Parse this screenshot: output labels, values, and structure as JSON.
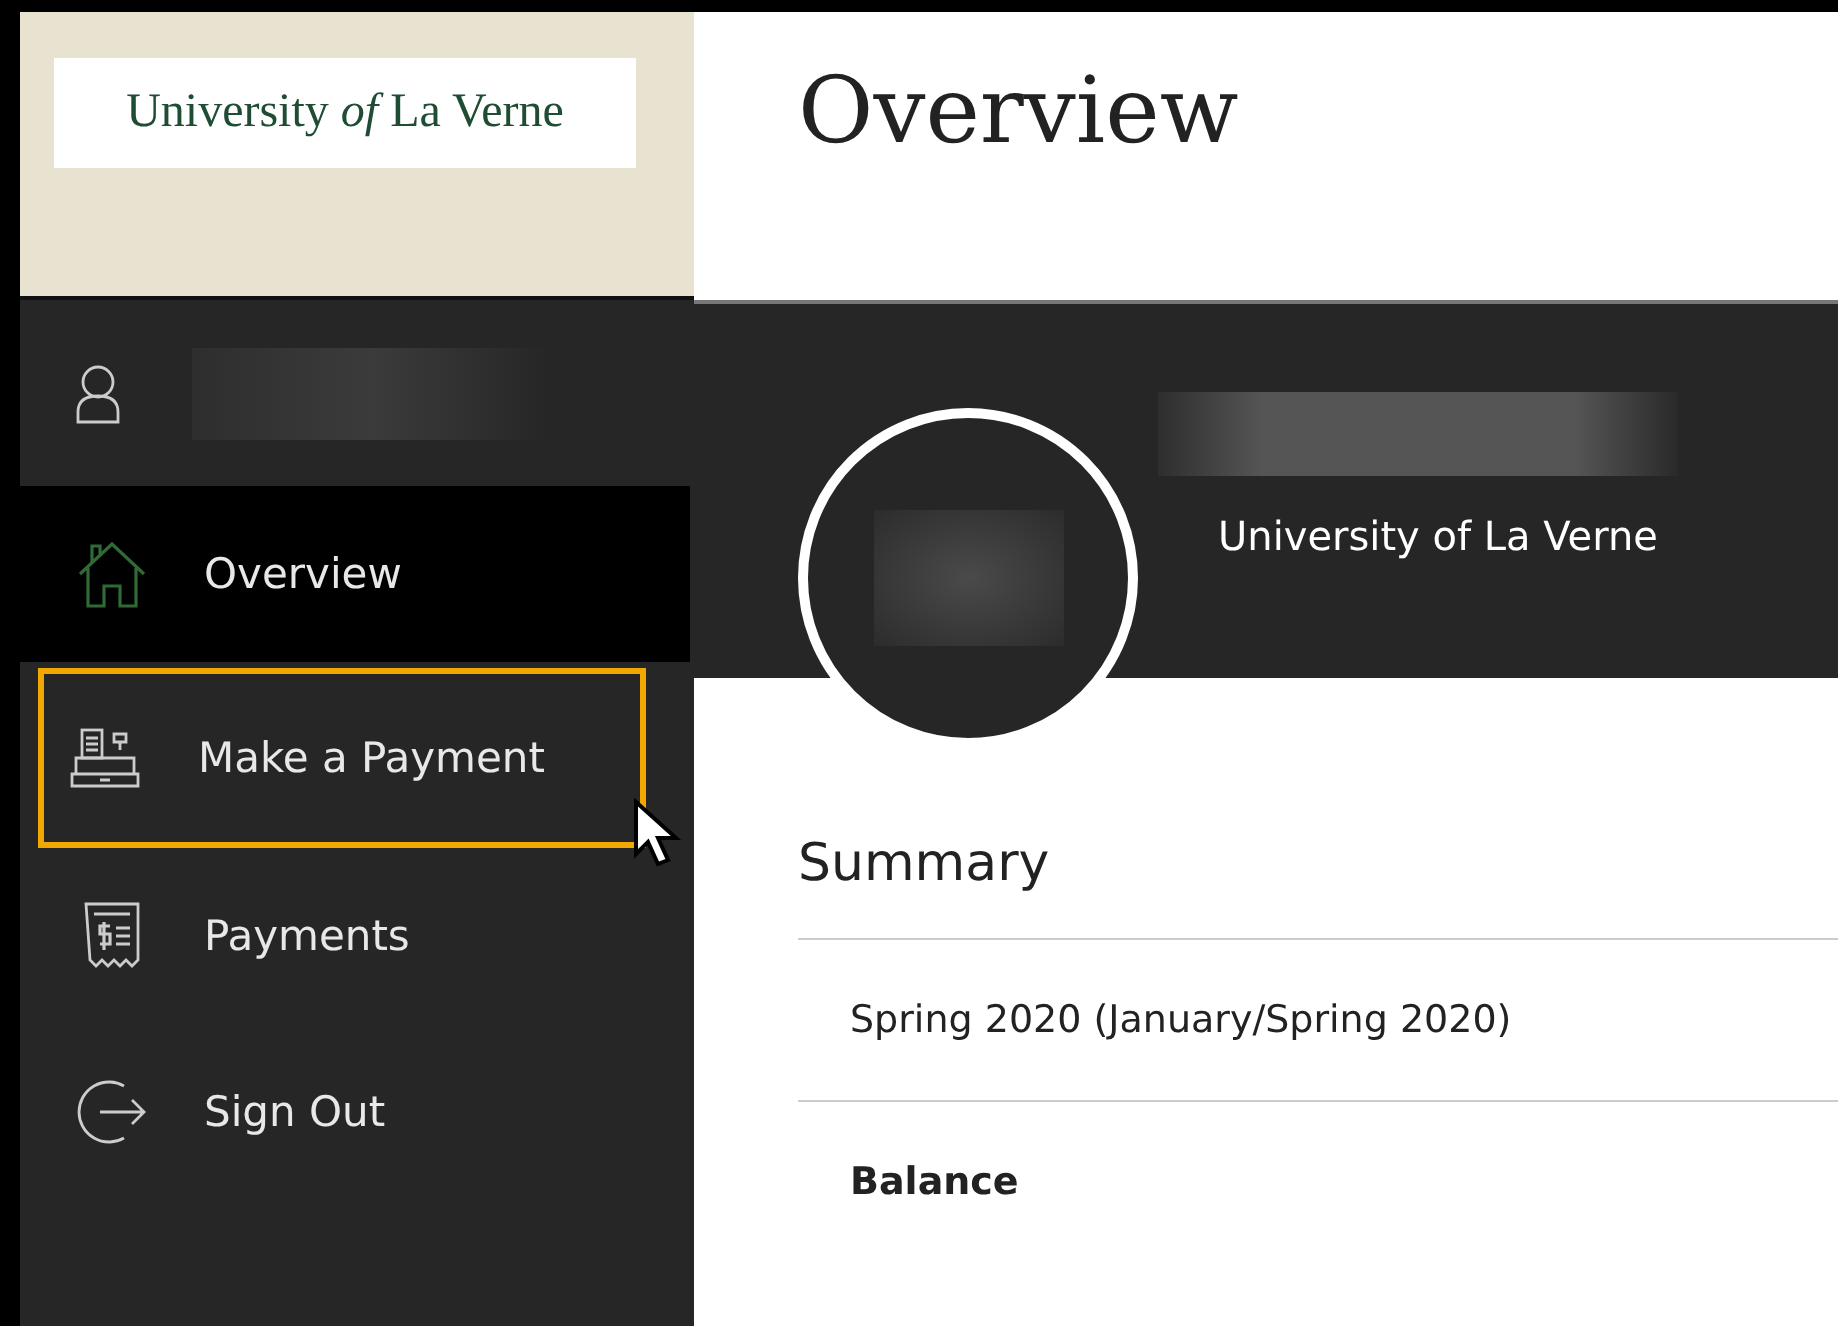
{
  "logo": {
    "text": "University *of* La Verne"
  },
  "page_title": "Overview",
  "sidebar": {
    "items": [
      {
        "kind": "home",
        "label": "Overview",
        "selected": true,
        "focused": false
      },
      {
        "kind": "register",
        "label": "Make a Payment",
        "selected": false,
        "focused": true
      },
      {
        "kind": "receipt",
        "label": "Payments",
        "selected": false,
        "focused": false
      },
      {
        "kind": "signout",
        "label": "Sign Out",
        "selected": false,
        "focused": false
      }
    ]
  },
  "profile": {
    "institution": "University of La Verne"
  },
  "summary": {
    "title": "Summary",
    "rows": [
      {
        "label": "Spring 2020 (January/Spring 2020)",
        "bold": false
      },
      {
        "label": "Balance",
        "bold": true
      }
    ]
  }
}
